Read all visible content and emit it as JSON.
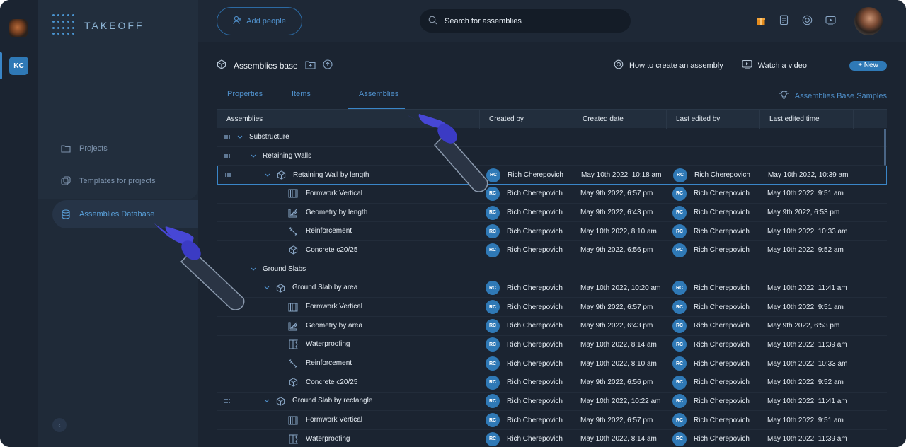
{
  "brand": {
    "name": "TAKEOFF"
  },
  "workspace": {
    "initials": "KC"
  },
  "sidebar": {
    "items": [
      {
        "label": "Projects",
        "icon": "folder-icon",
        "active": false
      },
      {
        "label": "Templates for projects",
        "icon": "templates-icon",
        "active": false
      },
      {
        "label": "Assemblies Database",
        "icon": "database-icon",
        "active": true
      }
    ],
    "collapse_label": "‹"
  },
  "topbar": {
    "add_people_label": "Add people",
    "search_placeholder": "Search for assemblies",
    "icons": [
      "gift-icon",
      "document-icon",
      "help-icon",
      "video-icon"
    ]
  },
  "page": {
    "title": "Assemblies base",
    "how_to_label": "How to create an assembly",
    "watch_video_label": "Watch a video",
    "new_label": "+ New",
    "samples_label": "Assemblies Base Samples"
  },
  "tabs": [
    {
      "label": "Properties",
      "active": false
    },
    {
      "label": "Items",
      "active": false
    },
    {
      "label": "Assemblies",
      "active": true
    }
  ],
  "table": {
    "headers": [
      "Assemblies",
      "Created by",
      "Created date",
      "Last edited by",
      "Last edited time"
    ],
    "rows": [
      {
        "level": 0,
        "name": "Substructure",
        "icon": "",
        "drag": true,
        "chevron": true,
        "created_by": "",
        "created_date": "",
        "edited_by": "",
        "edited_time": ""
      },
      {
        "level": 1,
        "name": "Retaining Walls",
        "icon": "",
        "drag": true,
        "chevron": true,
        "created_by": "",
        "created_date": "",
        "edited_by": "",
        "edited_time": ""
      },
      {
        "level": 2,
        "name": "Retaining Wall by length",
        "icon": "cube-icon",
        "drag": true,
        "chevron": true,
        "selected": true,
        "created_by": "Rich Cherepovich",
        "created_date": "May 10th 2022, 10:18 am",
        "edited_by": "Rich Cherepovich",
        "edited_time": "May 10th 2022, 10:39 am"
      },
      {
        "level": 3,
        "name": "Formwork Vertical",
        "icon": "formwork-icon",
        "created_by": "Rich Cherepovich",
        "created_date": "May 9th 2022, 6:57 pm",
        "edited_by": "Rich Cherepovich",
        "edited_time": "May 10th 2022, 9:51 am"
      },
      {
        "level": 3,
        "name": "Geometry by length",
        "icon": "geometry-icon",
        "created_by": "Rich Cherepovich",
        "created_date": "May 9th 2022, 6:43 pm",
        "edited_by": "Rich Cherepovich",
        "edited_time": "May 9th 2022, 6:53 pm"
      },
      {
        "level": 3,
        "name": "Reinforcement",
        "icon": "rebar-icon",
        "created_by": "Rich Cherepovich",
        "created_date": "May 10th 2022, 8:10 am",
        "edited_by": "Rich Cherepovich",
        "edited_time": "May 10th 2022, 10:33 am"
      },
      {
        "level": 3,
        "name": "Concrete c20/25",
        "icon": "cube-icon",
        "created_by": "Rich Cherepovich",
        "created_date": "May 9th 2022, 6:56 pm",
        "edited_by": "Rich Cherepovich",
        "edited_time": "May 10th 2022, 9:52 am"
      },
      {
        "level": 1,
        "name": "Ground Slabs",
        "icon": "",
        "chevron": true,
        "created_by": "",
        "created_date": "",
        "edited_by": "",
        "edited_time": ""
      },
      {
        "level": 2,
        "name": "Ground Slab by area",
        "icon": "cube-icon",
        "chevron": true,
        "created_by": "Rich Cherepovich",
        "created_date": "May 10th 2022, 10:20 am",
        "edited_by": "Rich Cherepovich",
        "edited_time": "May 10th 2022, 11:41 am"
      },
      {
        "level": 3,
        "name": "Formwork Vertical",
        "icon": "formwork-icon",
        "created_by": "Rich Cherepovich",
        "created_date": "May 9th 2022, 6:57 pm",
        "edited_by": "Rich Cherepovich",
        "edited_time": "May 10th 2022, 9:51 am"
      },
      {
        "level": 3,
        "name": "Geometry by area",
        "icon": "geometry-icon",
        "created_by": "Rich Cherepovich",
        "created_date": "May 9th 2022, 6:43 pm",
        "edited_by": "Rich Cherepovich",
        "edited_time": "May 9th 2022, 6:53 pm"
      },
      {
        "level": 3,
        "name": "Waterproofing",
        "icon": "waterproofing-icon",
        "created_by": "Rich Cherepovich",
        "created_date": "May 10th 2022, 8:14 am",
        "edited_by": "Rich Cherepovich",
        "edited_time": "May 10th 2022, 11:39 am"
      },
      {
        "level": 3,
        "name": "Reinforcement",
        "icon": "rebar-icon",
        "created_by": "Rich Cherepovich",
        "created_date": "May 10th 2022, 8:10 am",
        "edited_by": "Rich Cherepovich",
        "edited_time": "May 10th 2022, 10:33 am"
      },
      {
        "level": 3,
        "name": "Concrete c20/25",
        "icon": "cube-icon",
        "created_by": "Rich Cherepovich",
        "created_date": "May 9th 2022, 6:56 pm",
        "edited_by": "Rich Cherepovich",
        "edited_time": "May 10th 2022, 9:52 am"
      },
      {
        "level": 2,
        "name": "Ground Slab by rectangle",
        "icon": "cube-icon",
        "drag": true,
        "chevron": true,
        "created_by": "Rich Cherepovich",
        "created_date": "May 10th 2022, 10:22 am",
        "edited_by": "Rich Cherepovich",
        "edited_time": "May 10th 2022, 11:41 am"
      },
      {
        "level": 3,
        "name": "Formwork Vertical",
        "icon": "formwork-icon",
        "created_by": "Rich Cherepovich",
        "created_date": "May 9th 2022, 6:57 pm",
        "edited_by": "Rich Cherepovich",
        "edited_time": "May 10th 2022, 9:51 am"
      },
      {
        "level": 3,
        "name": "Waterproofing",
        "icon": "waterproofing-icon",
        "created_by": "Rich Cherepovich",
        "created_date": "May 10th 2022, 8:14 am",
        "edited_by": "Rich Cherepovich",
        "edited_time": "May 10th 2022, 11:39 am"
      }
    ],
    "avatar_initials": "RC"
  },
  "colors": {
    "accent": "#2f79b6",
    "link": "#4f8fca",
    "background": "#1b2431",
    "sidebar": "#1f2a38",
    "pointer": "#4747d6"
  }
}
